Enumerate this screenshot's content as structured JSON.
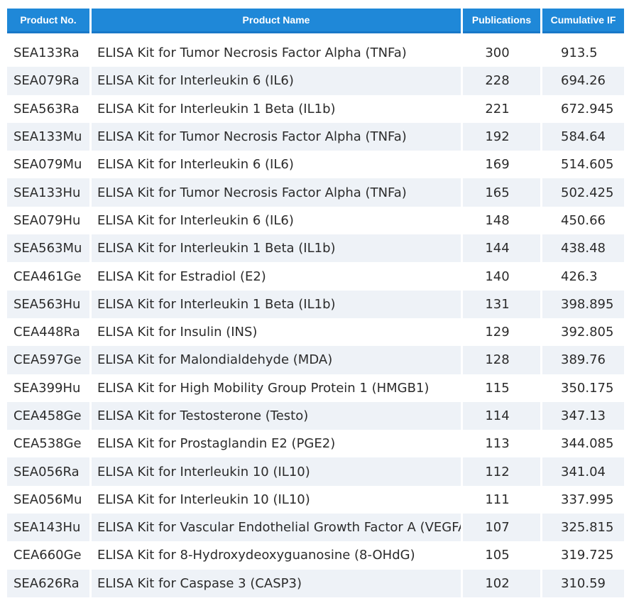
{
  "table": {
    "headers": [
      "Product No.",
      "Product Name",
      "Publications",
      "Cumulative IF"
    ],
    "rows": [
      [
        "SEA133Ra",
        "ELISA Kit for Tumor Necrosis Factor Alpha (TNFa)",
        "300",
        "913.5"
      ],
      [
        "SEA079Ra",
        "ELISA Kit for Interleukin 6 (IL6)",
        "228",
        "694.26"
      ],
      [
        "SEA563Ra",
        "ELISA Kit for Interleukin 1 Beta (IL1b)",
        "221",
        "672.945"
      ],
      [
        "SEA133Mu",
        "ELISA Kit for Tumor Necrosis Factor Alpha (TNFa)",
        "192",
        "584.64"
      ],
      [
        "SEA079Mu",
        "ELISA Kit for Interleukin 6 (IL6)",
        "169",
        "514.605"
      ],
      [
        "SEA133Hu",
        "ELISA Kit for Tumor Necrosis Factor Alpha (TNFa)",
        "165",
        "502.425"
      ],
      [
        "SEA079Hu",
        "ELISA Kit for Interleukin 6 (IL6)",
        "148",
        "450.66"
      ],
      [
        "SEA563Mu",
        "ELISA Kit for Interleukin 1 Beta (IL1b)",
        "144",
        "438.48"
      ],
      [
        "CEA461Ge",
        "ELISA Kit for Estradiol (E2)",
        "140",
        "426.3"
      ],
      [
        "SEA563Hu",
        "ELISA Kit for Interleukin 1 Beta (IL1b)",
        "131",
        "398.895"
      ],
      [
        "CEA448Ra",
        "ELISA Kit for Insulin (INS)",
        "129",
        "392.805"
      ],
      [
        "CEA597Ge",
        "ELISA Kit for Malondialdehyde (MDA)",
        "128",
        "389.76"
      ],
      [
        "SEA399Hu",
        "ELISA Kit for High Mobility Group Protein 1 (HMGB1)",
        "115",
        "350.175"
      ],
      [
        "CEA458Ge",
        "ELISA Kit for Testosterone (Testo)",
        "114",
        "347.13"
      ],
      [
        "CEA538Ge",
        "ELISA Kit for Prostaglandin E2 (PGE2)",
        "113",
        "344.085"
      ],
      [
        "SEA056Ra",
        "ELISA Kit for Interleukin 10 (IL10)",
        "112",
        "341.04"
      ],
      [
        "SEA056Mu",
        "ELISA Kit for Interleukin 10 (IL10)",
        "111",
        "337.995"
      ],
      [
        "SEA143Hu",
        "ELISA Kit for Vascular Endothelial Growth Factor A (VEGFA)",
        "107",
        "325.815"
      ],
      [
        "CEA660Ge",
        "ELISA Kit for 8-Hydroxydeoxyguanosine (8-OHdG)",
        "105",
        "319.725"
      ],
      [
        "SEA626Ra",
        "ELISA Kit for Caspase 3 (CASP3)",
        "102",
        "310.59"
      ]
    ]
  },
  "colors": {
    "header_bg": "#1f88d8",
    "header_text": "#ffffff",
    "row_alt_bg": "#eef2f7",
    "cell_text": "#2b2b2b"
  }
}
